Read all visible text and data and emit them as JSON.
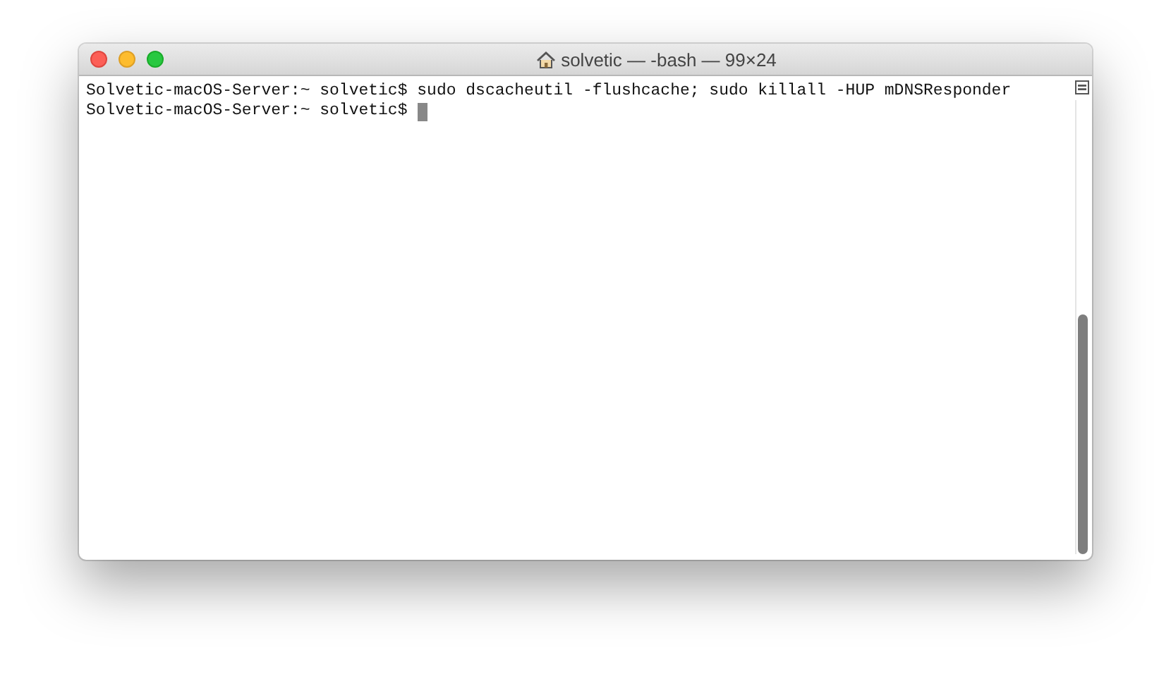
{
  "window": {
    "title": "solvetic — -bash — 99×24"
  },
  "terminal": {
    "lines": [
      {
        "text": "Solvetic-macOS-Server:~ solvetic$ sudo dscacheutil -flushcache; sudo killall -HUP mDNSResponder",
        "cursor": false
      },
      {
        "text": "Solvetic-macOS-Server:~ solvetic$ ",
        "cursor": true
      }
    ]
  }
}
